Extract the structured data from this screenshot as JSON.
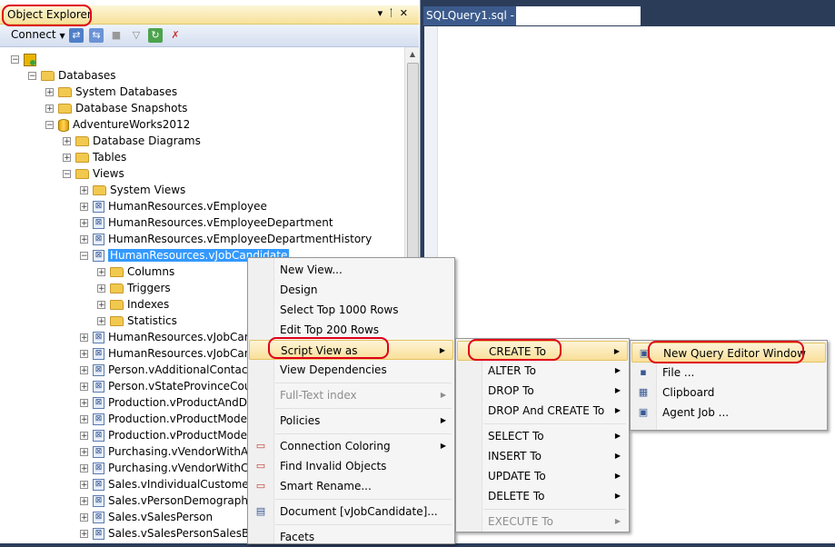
{
  "object_explorer": {
    "title": "Object Explorer",
    "title_controls": [
      "▾",
      "ᛙ",
      "✕"
    ],
    "toolbar": {
      "connect_label": "Connect"
    },
    "tree": [
      {
        "label": "",
        "kind": "server",
        "exp": "−"
      },
      {
        "label": "Databases",
        "kind": "folder",
        "exp": "−"
      },
      {
        "label": "System Databases",
        "kind": "folder",
        "exp": "+"
      },
      {
        "label": "Database Snapshots",
        "kind": "folder",
        "exp": "+"
      },
      {
        "label": "AdventureWorks2012",
        "kind": "db",
        "exp": "−"
      },
      {
        "label": "Database Diagrams",
        "kind": "folder",
        "exp": "+"
      },
      {
        "label": "Tables",
        "kind": "folder",
        "exp": "+"
      },
      {
        "label": "Views",
        "kind": "folder",
        "exp": "−"
      },
      {
        "label": "System Views",
        "kind": "folder",
        "exp": "+"
      },
      {
        "label": "HumanResources.vEmployee",
        "kind": "view",
        "exp": "+"
      },
      {
        "label": "HumanResources.vEmployeeDepartment",
        "kind": "view",
        "exp": "+"
      },
      {
        "label": "HumanResources.vEmployeeDepartmentHistory",
        "kind": "view",
        "exp": "+"
      },
      {
        "label": "HumanResources.vJobCandidate",
        "kind": "view",
        "exp": "−",
        "selected": true
      },
      {
        "label": "Columns",
        "kind": "folder",
        "exp": "+"
      },
      {
        "label": "Triggers",
        "kind": "folder",
        "exp": "+"
      },
      {
        "label": "Indexes",
        "kind": "folder",
        "exp": "+"
      },
      {
        "label": "Statistics",
        "kind": "folder",
        "exp": "+"
      },
      {
        "label": "HumanResources.vJobCanc",
        "kind": "view",
        "exp": "+"
      },
      {
        "label": "HumanResources.vJobCanc",
        "kind": "view",
        "exp": "+"
      },
      {
        "label": "Person.vAdditionalContactI",
        "kind": "view",
        "exp": "+"
      },
      {
        "label": "Person.vStateProvinceCoun",
        "kind": "view",
        "exp": "+"
      },
      {
        "label": "Production.vProductAndDe",
        "kind": "view",
        "exp": "+"
      },
      {
        "label": "Production.vProductModel",
        "kind": "view",
        "exp": "+"
      },
      {
        "label": "Production.vProductModel",
        "kind": "view",
        "exp": "+"
      },
      {
        "label": "Purchasing.vVendorWithAd",
        "kind": "view",
        "exp": "+"
      },
      {
        "label": "Purchasing.vVendorWithCo",
        "kind": "view",
        "exp": "+"
      },
      {
        "label": "Sales.vIndividualCustomer",
        "kind": "view",
        "exp": "+"
      },
      {
        "label": "Sales.vPersonDemographics",
        "kind": "view",
        "exp": "+"
      },
      {
        "label": "Sales.vSalesPerson",
        "kind": "view",
        "exp": "+"
      },
      {
        "label": "Sales.vSalesPersonSalesByFi",
        "kind": "view",
        "exp": "+"
      }
    ]
  },
  "query_tab": {
    "label": "SQLQuery1.sql -"
  },
  "context_menu": [
    {
      "label": "New View...",
      "top": 0
    },
    {
      "label": "Design"
    },
    {
      "label": "Select Top 1000 Rows"
    },
    {
      "label": "Edit Top 200 Rows"
    },
    {
      "label": "Script View as",
      "arrow": true,
      "highlighted": true
    },
    {
      "label": "View Dependencies"
    },
    {
      "sep": true
    },
    {
      "label": "Full-Text index",
      "arrow": true,
      "disabled": true
    },
    {
      "sep": true
    },
    {
      "label": "Policies",
      "arrow": true
    },
    {
      "sep": true
    },
    {
      "label": "Connection Coloring",
      "arrow": true,
      "icon": "connection-coloring-icon"
    },
    {
      "label": "Find Invalid Objects",
      "icon": "find-invalid-objects-icon"
    },
    {
      "label": "Smart Rename...",
      "icon": "smart-rename-icon"
    },
    {
      "sep": true
    },
    {
      "label": "Document [vJobCandidate]...",
      "icon": "document-icon"
    },
    {
      "sep": true
    },
    {
      "label": "Facets"
    }
  ],
  "script_submenu": [
    {
      "label": "CREATE To",
      "arrow": true,
      "highlighted": true
    },
    {
      "label": "ALTER To",
      "arrow": true
    },
    {
      "label": "DROP To",
      "arrow": true
    },
    {
      "label": "DROP And CREATE To",
      "arrow": true
    },
    {
      "sep": true
    },
    {
      "label": "SELECT To",
      "arrow": true
    },
    {
      "label": "INSERT To",
      "arrow": true
    },
    {
      "label": "UPDATE To",
      "arrow": true
    },
    {
      "label": "DELETE To",
      "arrow": true
    },
    {
      "sep": true
    },
    {
      "label": "EXECUTE To",
      "arrow": true,
      "disabled": true
    }
  ],
  "create_submenu": [
    {
      "label": "New Query Editor Window",
      "highlighted": true,
      "icon": "query-window-icon"
    },
    {
      "label": "File ...",
      "icon": "save-icon"
    },
    {
      "label": "Clipboard",
      "icon": "clipboard-icon"
    },
    {
      "label": "Agent Job ...",
      "icon": "agent-job-icon"
    }
  ],
  "colors": {
    "accent": "#3399ff",
    "highlight_ring": "#e0001a",
    "background": "#2b3c59"
  }
}
